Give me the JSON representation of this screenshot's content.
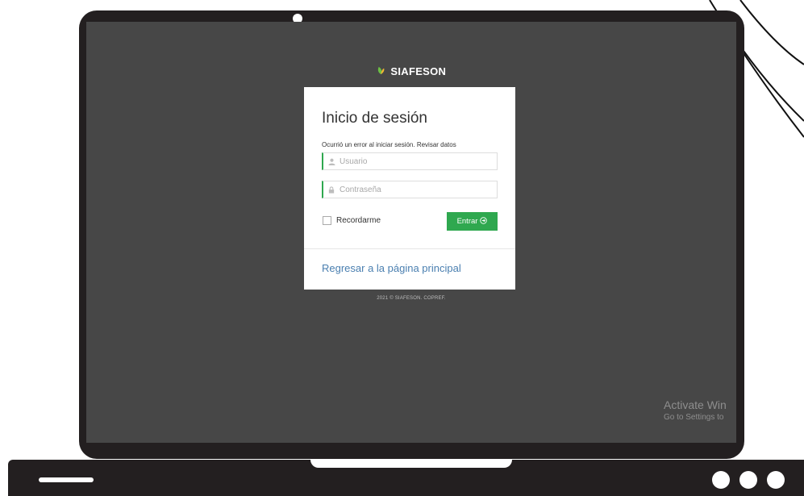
{
  "brand": {
    "name": "SIAFESON",
    "logo_icon": "leaf-icon"
  },
  "login_card": {
    "title": "Inicio de sesión",
    "error_message": "Ocurrió un error al iniciar sesión. Revisar datos",
    "username_placeholder": "Usuario",
    "username_icon": "user-icon",
    "password_placeholder": "Contraseña",
    "password_icon": "lock-icon",
    "remember_label": "Recordarme",
    "submit_label": "Entrar",
    "submit_icon": "arrow-circle-right-icon",
    "back_link": "Regresar a la página principal"
  },
  "footer": {
    "text": "2021 © SIAFESON. COPREF."
  },
  "watermark": {
    "line1": "Activate Win",
    "line2": "Go to Settings to"
  },
  "colors": {
    "accent_green": "#2fa84f",
    "link_blue": "#4a7fb0",
    "screen_bg": "#474747",
    "device": "#231f20"
  }
}
